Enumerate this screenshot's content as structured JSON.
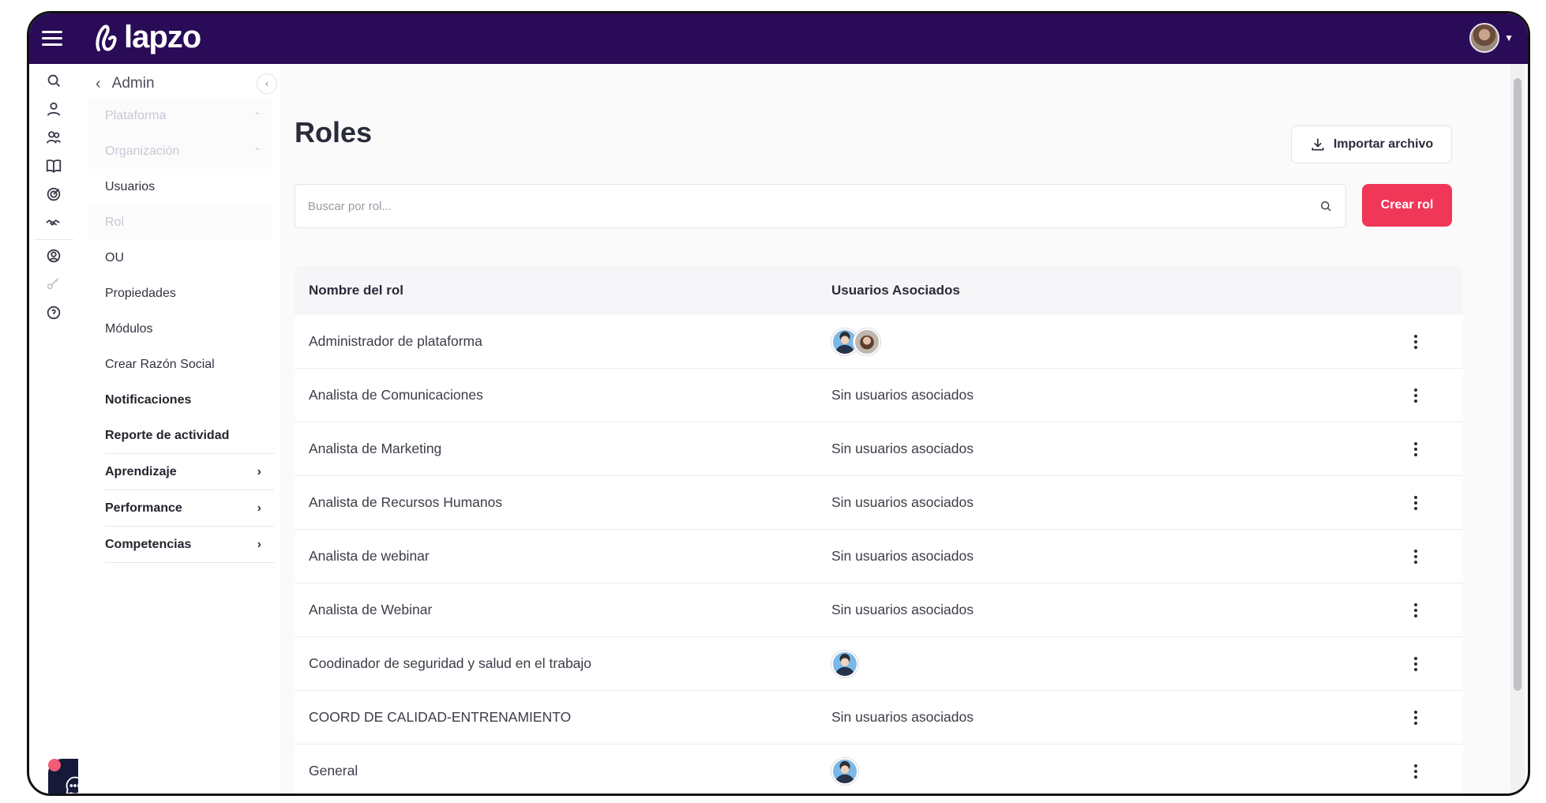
{
  "brand": {
    "name": "lapzo"
  },
  "sidebar": {
    "back_label": "Admin",
    "items": [
      {
        "label": "Plataforma",
        "state": "collapsed"
      },
      {
        "label": "Organización",
        "state": "expanded"
      },
      {
        "label": "Usuarios"
      },
      {
        "label": "Rol",
        "state": "active"
      },
      {
        "label": "OU"
      },
      {
        "label": "Propiedades"
      },
      {
        "label": "Módulos"
      },
      {
        "label": "Crear Razón Social"
      },
      {
        "label": "Notificaciones"
      },
      {
        "label": "Reporte de actividad"
      },
      {
        "label": "Aprendizaje"
      },
      {
        "label": "Performance"
      },
      {
        "label": "Competencias"
      }
    ]
  },
  "rail": {
    "icons": [
      "search-icon",
      "user-icon",
      "users-icon",
      "book-icon",
      "target-icon",
      "handshake-icon",
      "person-search-icon",
      "key-icon",
      "help-icon"
    ]
  },
  "main": {
    "title": "Roles",
    "import_label": "Importar archivo",
    "search_placeholder": "Buscar por rol...",
    "create_label": "Crear rol",
    "table": {
      "headers": [
        "Nombre del rol",
        "Usuarios Asociados"
      ],
      "rows": [
        {
          "name": "Administrador de plataforma",
          "users": "",
          "avatars": [
            "male",
            "female"
          ]
        },
        {
          "name": "Analista de Comunicaciones",
          "users": "Sin usuarios asociados",
          "avatars": []
        },
        {
          "name": "Analista de Marketing",
          "users": "Sin usuarios asociados",
          "avatars": []
        },
        {
          "name": "Analista de Recursos Humanos",
          "users": "Sin usuarios asociados",
          "avatars": []
        },
        {
          "name": "Analista de webinar",
          "users": "Sin usuarios asociados",
          "avatars": []
        },
        {
          "name": "Analista de Webinar",
          "users": "Sin usuarios asociados",
          "avatars": []
        },
        {
          "name": "Coodinador de seguridad y salud en el trabajo",
          "users": "",
          "avatars": [
            "male"
          ]
        },
        {
          "name": "COORD DE CALIDAD-ENTRENAMIENTO",
          "users": "Sin usuarios asociados",
          "avatars": []
        },
        {
          "name": "General",
          "users": "",
          "avatars": [
            "male"
          ]
        }
      ]
    }
  },
  "colors": {
    "topbar": "#2a0b57",
    "accent": "#f03758",
    "chat_fab": "#151a3a"
  }
}
